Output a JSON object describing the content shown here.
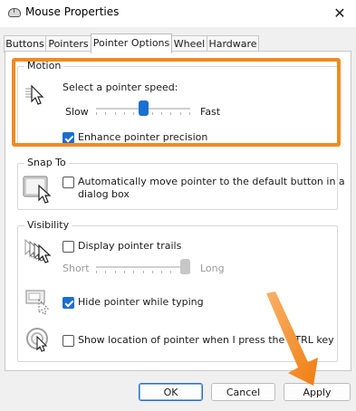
{
  "window": {
    "title": "Mouse Properties",
    "close_glyph": "✕"
  },
  "tabs": [
    {
      "label": "Buttons"
    },
    {
      "label": "Pointers"
    },
    {
      "label": "Pointer Options"
    },
    {
      "label": "Wheel"
    },
    {
      "label": "Hardware"
    }
  ],
  "motion": {
    "group_label": "Motion",
    "speed_label": "Select a pointer speed:",
    "slow_label": "Slow",
    "fast_label": "Fast",
    "speed_level": 0.5,
    "enhance_label": "Enhance pointer precision",
    "enhance_checked": true
  },
  "snap_to": {
    "group_label": "Snap To",
    "auto_label_line1": "Automatically move pointer to the default button in a",
    "auto_label_line2": "dialog box",
    "auto_checked": false
  },
  "visibility": {
    "group_label": "Visibility",
    "trails_label": "Display pointer trails",
    "trails_checked": false,
    "short_label": "Short",
    "long_label": "Long",
    "trail_level": 1.0,
    "hide_label": "Hide pointer while typing",
    "hide_checked": true,
    "show_location_label": "Show location of pointer when I press the CTRL key",
    "show_location_checked": false
  },
  "buttons": {
    "ok": "OK",
    "cancel": "Cancel",
    "apply": "Apply"
  },
  "colors": {
    "accent": "#1a6fd0",
    "annotation": "#f28a21"
  }
}
